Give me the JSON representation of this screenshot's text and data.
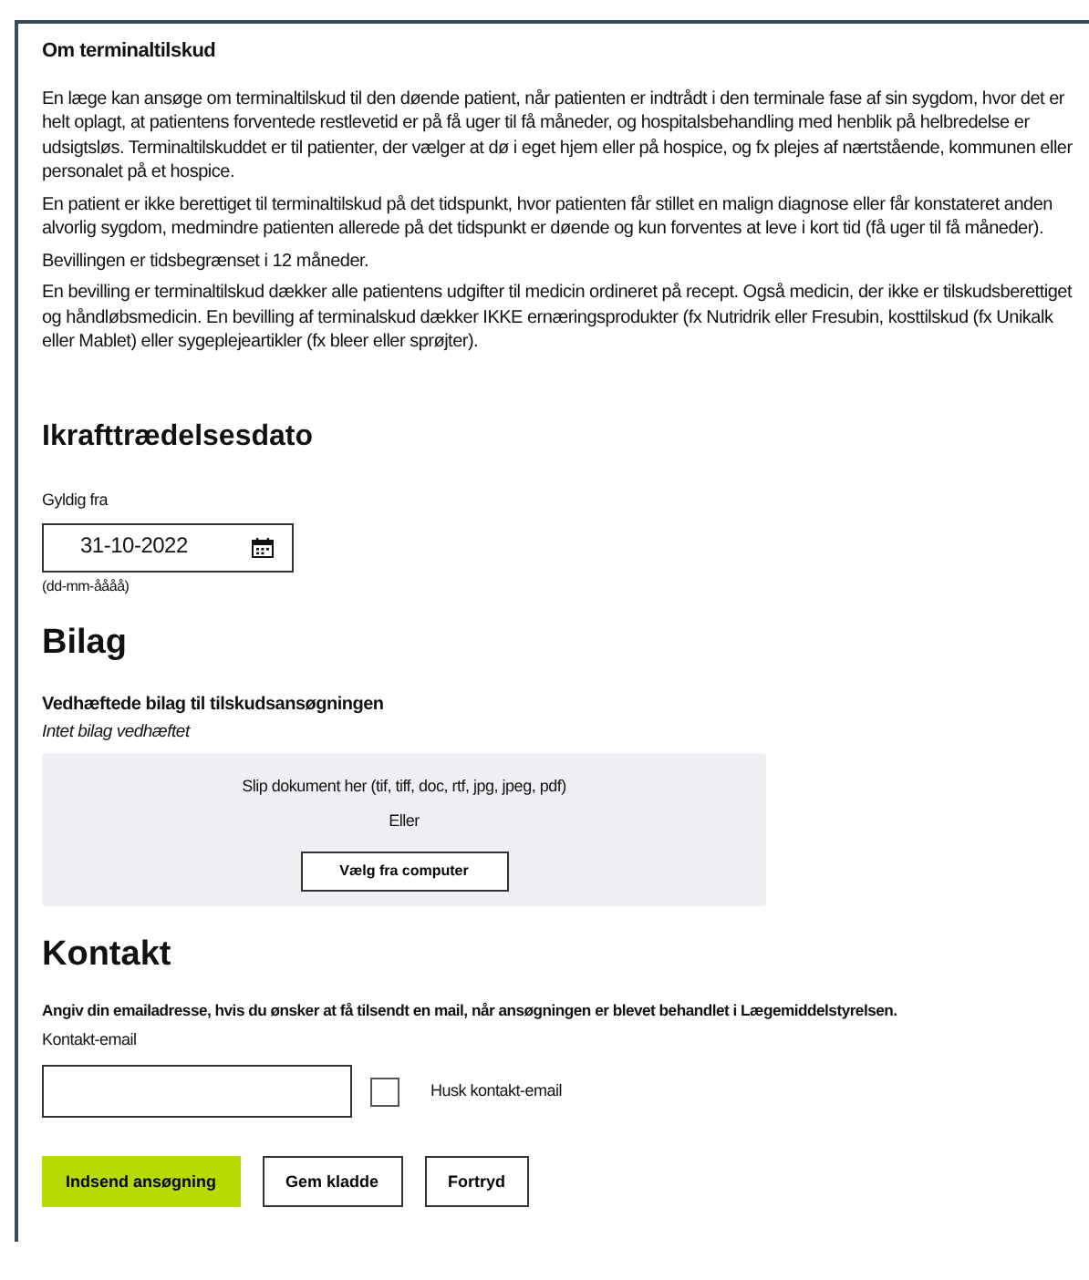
{
  "info": {
    "title": "Om terminaltilskud",
    "paragraphs": [
      "En læge kan ansøge om terminaltilskud til den døende patient, når patienten er indtrådt i den terminale fase af sin sygdom, hvor det er helt oplagt, at patientens forventede restlevetid er på få uger til få måneder, og hospitalsbehandling med henblik på helbredelse er udsigtsløs. Terminaltilskuddet er til patienter, der vælger at dø i eget hjem eller på hospice, og fx plejes af nærtstående, kommunen eller personalet på et hospice.",
      "En patient er ikke berettiget til terminaltilskud på det tidspunkt, hvor patienten får stillet en malign diagnose eller får konstateret anden alvorlig sygdom, medmindre patienten allerede på det tidspunkt er døende og kun forventes at leve i kort tid (få uger til få måneder).",
      "Bevillingen er tidsbegrænset i 12 måneder.",
      "En bevilling er terminaltilskud dækker alle patientens udgifter til medicin ordineret på recept. Også medicin, der ikke er tilskudsberettiget og håndløbsmedicin. En bevilling af terminalskud dækker IKKE ernæringsprodukter (fx Nutridrik eller Fresubin, kosttilskud (fx Unikalk eller Mablet) eller sygeplejeartikler (fx bleer eller sprøjter)."
    ]
  },
  "effective_date": {
    "heading": "Ikrafttrædelsesdato",
    "label": "Gyldig fra",
    "value": "31-10-2022",
    "format_hint": "(dd-mm-åååå)"
  },
  "attachments": {
    "heading": "Bilag",
    "subheading": "Vedhæftede bilag til tilskudsansøgningen",
    "status": "Intet bilag vedhæftet",
    "drop_text": "Slip dokument her (tif, tiff, doc, rtf, jpg, jpeg, pdf)",
    "or_text": "Eller",
    "choose_button": "Vælg fra computer"
  },
  "contact": {
    "heading": "Kontakt",
    "instruction": "Angiv din emailadresse, hvis du ønsker at få tilsendt en mail, når ansøgningen er blevet behandlet i Lægemiddelstyrelsen.",
    "email_label": "Kontakt-email",
    "remember": {
      "label": "Husk kontakt-email",
      "checked": false
    }
  },
  "actions": [
    {
      "label": "Indsend ansøgning",
      "kind": "primary"
    },
    {
      "label": "Gem kladde",
      "kind": "secondary"
    },
    {
      "label": "Fortryd",
      "kind": "secondary"
    }
  ]
}
